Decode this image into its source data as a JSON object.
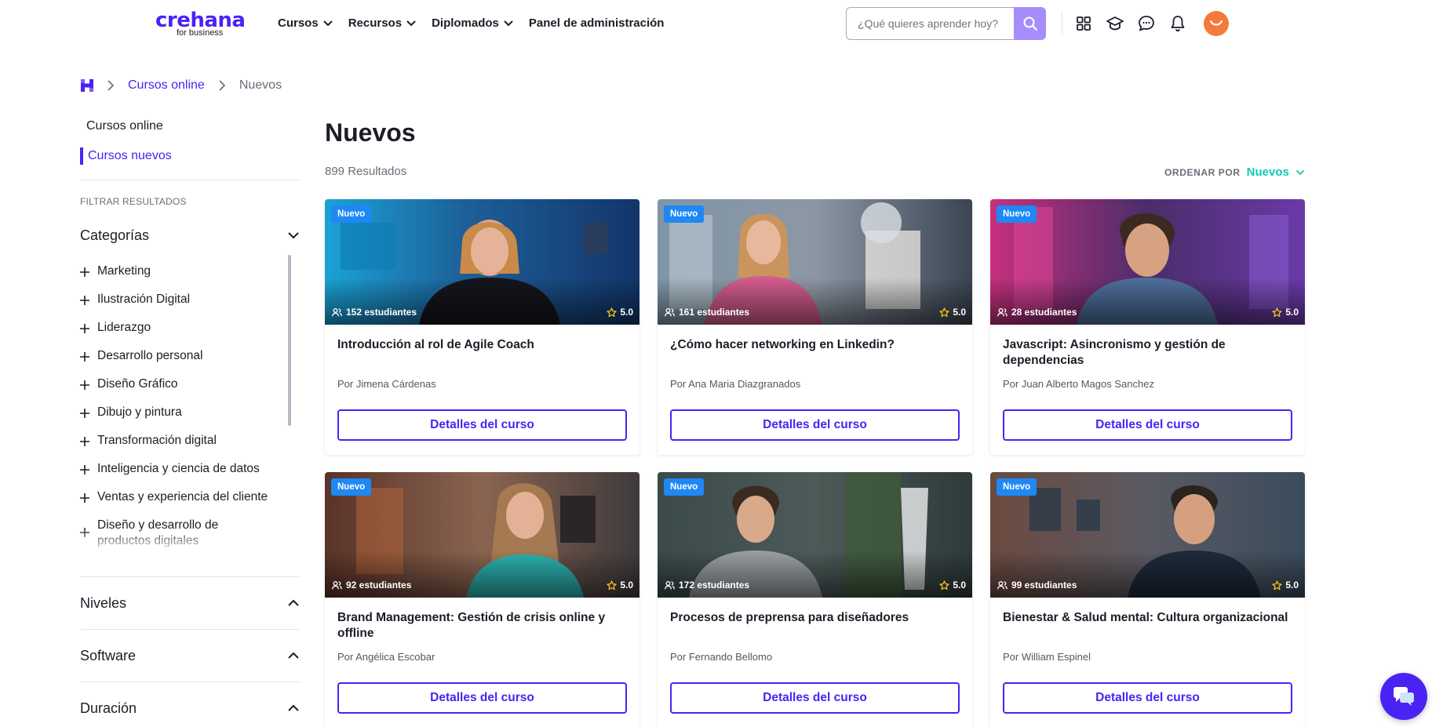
{
  "brand": {
    "name": "crehana",
    "tagline": "for business",
    "accent": "#4b22f4"
  },
  "nav": [
    {
      "label": "Cursos"
    },
    {
      "label": "Recursos"
    },
    {
      "label": "Diplomados"
    },
    {
      "label": "Panel de administración"
    }
  ],
  "search": {
    "placeholder": "¿Qué quieres aprender hoy?"
  },
  "header_icons": [
    "grid-icon",
    "graduation-cap-icon",
    "chat-bubble-icon",
    "bell-icon"
  ],
  "breadcrumb": {
    "items": [
      "Cursos online",
      "Nuevos"
    ]
  },
  "sidebar": {
    "links": [
      "Cursos online",
      "Cursos nuevos"
    ],
    "filter_title": "FILTRAR RESULTADOS",
    "categories_title": "Categorías",
    "categories": [
      "Marketing",
      "Ilustración Digital",
      "Liderazgo",
      "Desarrollo personal",
      "Diseño Gráfico",
      "Dibujo y pintura",
      "Transformación digital",
      "Inteligencia y ciencia de datos",
      "Ventas y experiencia del cliente",
      "Diseño y desarrollo de productos digitales"
    ],
    "sections": [
      "Niveles",
      "Software",
      "Duración"
    ]
  },
  "main": {
    "title": "Nuevos",
    "results": "899 Resultados",
    "sort_label": "ORDENAR POR",
    "sort_value": "Nuevos"
  },
  "courses": [
    {
      "badge": "Nuevo",
      "students": "152 estudiantes",
      "rating": "5.0",
      "title": "Introducción al rol de Agile Coach",
      "author": "Por Jimena Cárdenas",
      "button": "Detalles del curso"
    },
    {
      "badge": "Nuevo",
      "students": "161 estudiantes",
      "rating": "5.0",
      "title": "¿Cómo hacer networking en Linkedin?",
      "author": "Por Ana Maria Diazgranados",
      "button": "Detalles del curso"
    },
    {
      "badge": "Nuevo",
      "students": "28 estudiantes",
      "rating": "5.0",
      "title": "Javascript: Asincronismo y gestión de dependencias",
      "author": "Por Juan Alberto Magos Sanchez",
      "button": "Detalles del curso"
    },
    {
      "badge": "Nuevo",
      "students": "92 estudiantes",
      "rating": "5.0",
      "title": "Brand Management: Gestión de crisis online y offline",
      "author": "Por Angélica Escobar",
      "button": "Detalles del curso"
    },
    {
      "badge": "Nuevo",
      "students": "172 estudiantes",
      "rating": "5.0",
      "title": "Procesos de preprensa para diseñadores",
      "author": "Por Fernando Bellomo",
      "button": "Detalles del curso"
    },
    {
      "badge": "Nuevo",
      "students": "99 estudiantes",
      "rating": "5.0",
      "title": "Bienestar & Salud mental: Cultura organizacional",
      "author": "Por William Espinel",
      "button": "Detalles del curso"
    }
  ]
}
